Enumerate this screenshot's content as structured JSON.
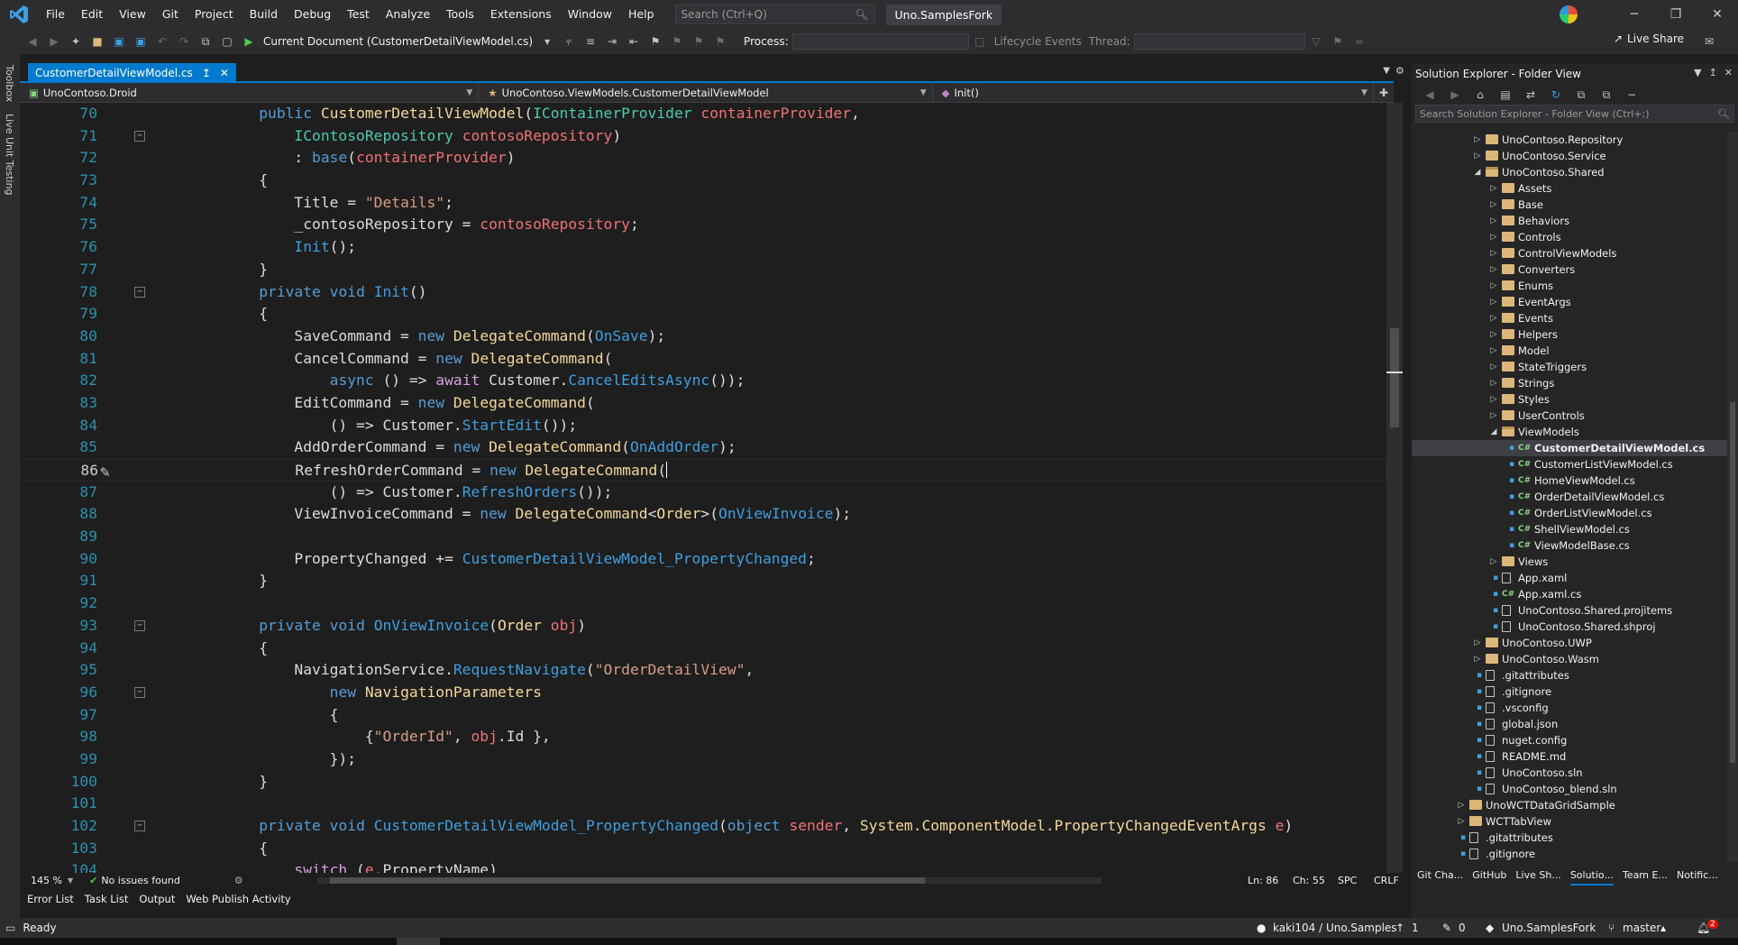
{
  "menu": {
    "items": [
      "File",
      "Edit",
      "View",
      "Git",
      "Project",
      "Build",
      "Debug",
      "Test",
      "Analyze",
      "Tools",
      "Extensions",
      "Window",
      "Help"
    ],
    "search_placeholder": "Search (Ctrl+Q)",
    "solution_name": "Uno.SamplesFork"
  },
  "toolbar": {
    "run_target": "Current Document (CustomerDetailViewModel.cs)",
    "process_label": "Process:",
    "lifecycle_label": "Lifecycle Events",
    "thread_label": "Thread:",
    "live_share": "Live Share"
  },
  "left_strip": {
    "toolbox": "Toolbox",
    "live_unit_testing": "Live Unit Testing"
  },
  "editor": {
    "tab_title": "CustomerDetailViewModel.cs",
    "nav_project": "UnoContoso.Droid",
    "nav_type": "UnoContoso.ViewModels.CustomerDetailViewModel",
    "nav_member": "Init()",
    "zoom": "145 %",
    "issues": "No issues found",
    "ln": "Ln: 86",
    "ch": "Ch: 55",
    "spc": "SPC",
    "crlf": "CRLF",
    "line_numbers": [
      "70",
      "71",
      "72",
      "73",
      "74",
      "75",
      "76",
      "77",
      "78",
      "79",
      "80",
      "81",
      "82",
      "83",
      "84",
      "85",
      "86",
      "87",
      "88",
      "89",
      "90",
      "91",
      "92",
      "93",
      "94",
      "95",
      "96",
      "97",
      "98",
      "99",
      "100",
      "101",
      "102",
      "103",
      "104"
    ]
  },
  "bottom_tabs": [
    "Error List",
    "Task List",
    "Output",
    "Web Publish Activity"
  ],
  "status": {
    "ready": "Ready",
    "repo": "kaki104 / Uno.Samples",
    "up_count": "1",
    "pencil_count": "0",
    "solution": "Uno.SamplesFork",
    "branch": "master",
    "notifications": "2"
  },
  "solution_explorer": {
    "title": "Solution Explorer - Folder View",
    "search_placeholder": "Search Solution Explorer - Folder View (Ctrl+;)",
    "tree": [
      {
        "label": "UnoContoso.Repository",
        "type": "folder",
        "level": 2,
        "arrow": "collapsed"
      },
      {
        "label": "UnoContoso.Service",
        "type": "folder",
        "level": 2,
        "arrow": "collapsed"
      },
      {
        "label": "UnoContoso.Shared",
        "type": "folder-open",
        "level": 2,
        "arrow": "expanded"
      },
      {
        "label": "Assets",
        "type": "folder",
        "level": 3,
        "arrow": "collapsed"
      },
      {
        "label": "Base",
        "type": "folder",
        "level": 3,
        "arrow": "collapsed"
      },
      {
        "label": "Behaviors",
        "type": "folder",
        "level": 3,
        "arrow": "collapsed"
      },
      {
        "label": "Controls",
        "type": "folder",
        "level": 3,
        "arrow": "collapsed"
      },
      {
        "label": "ControlViewModels",
        "type": "folder",
        "level": 3,
        "arrow": "collapsed"
      },
      {
        "label": "Converters",
        "type": "folder",
        "level": 3,
        "arrow": "collapsed"
      },
      {
        "label": "Enums",
        "type": "folder",
        "level": 3,
        "arrow": "collapsed"
      },
      {
        "label": "EventArgs",
        "type": "folder",
        "level": 3,
        "arrow": "collapsed"
      },
      {
        "label": "Events",
        "type": "folder",
        "level": 3,
        "arrow": "collapsed"
      },
      {
        "label": "Helpers",
        "type": "folder",
        "level": 3,
        "arrow": "collapsed"
      },
      {
        "label": "Model",
        "type": "folder",
        "level": 3,
        "arrow": "collapsed"
      },
      {
        "label": "StateTriggers",
        "type": "folder",
        "level": 3,
        "arrow": "collapsed"
      },
      {
        "label": "Strings",
        "type": "folder",
        "level": 3,
        "arrow": "collapsed"
      },
      {
        "label": "Styles",
        "type": "folder",
        "level": 3,
        "arrow": "collapsed"
      },
      {
        "label": "UserControls",
        "type": "folder",
        "level": 3,
        "arrow": "collapsed"
      },
      {
        "label": "ViewModels",
        "type": "folder-open",
        "level": 3,
        "arrow": "expanded"
      },
      {
        "label": "CustomerDetailViewModel.cs",
        "type": "cs",
        "level": 4,
        "selected": true
      },
      {
        "label": "CustomerListViewModel.cs",
        "type": "cs",
        "level": 4
      },
      {
        "label": "HomeViewModel.cs",
        "type": "cs",
        "level": 4
      },
      {
        "label": "OrderDetailViewModel.cs",
        "type": "cs",
        "level": 4
      },
      {
        "label": "OrderListViewModel.cs",
        "type": "cs",
        "level": 4
      },
      {
        "label": "ShellViewModel.cs",
        "type": "cs",
        "level": 4
      },
      {
        "label": "ViewModelBase.cs",
        "type": "cs",
        "level": 4
      },
      {
        "label": "Views",
        "type": "folder",
        "level": 3,
        "arrow": "collapsed"
      },
      {
        "label": "App.xaml",
        "type": "file",
        "level": 3
      },
      {
        "label": "App.xaml.cs",
        "type": "cs",
        "level": 3
      },
      {
        "label": "UnoContoso.Shared.projitems",
        "type": "file",
        "level": 3
      },
      {
        "label": "UnoContoso.Shared.shproj",
        "type": "file",
        "level": 3
      },
      {
        "label": "UnoContoso.UWP",
        "type": "folder",
        "level": 2,
        "arrow": "collapsed"
      },
      {
        "label": "UnoContoso.Wasm",
        "type": "folder",
        "level": 2,
        "arrow": "collapsed"
      },
      {
        "label": ".gitattributes",
        "type": "file",
        "level": 2
      },
      {
        "label": ".gitignore",
        "type": "file",
        "level": 2
      },
      {
        "label": ".vsconfig",
        "type": "file",
        "level": 2
      },
      {
        "label": "global.json",
        "type": "file",
        "level": 2
      },
      {
        "label": "nuget.config",
        "type": "file",
        "level": 2
      },
      {
        "label": "README.md",
        "type": "file",
        "level": 2
      },
      {
        "label": "UnoContoso.sln",
        "type": "file",
        "level": 2
      },
      {
        "label": "UnoContoso_blend.sln",
        "type": "file",
        "level": 2
      },
      {
        "label": "UnoWCTDataGridSample",
        "type": "folder",
        "level": 1,
        "arrow": "collapsed"
      },
      {
        "label": "WCTTabView",
        "type": "folder",
        "level": 1,
        "arrow": "collapsed"
      },
      {
        "label": ".gitattributes",
        "type": "file",
        "level": 1
      },
      {
        "label": ".gitignore",
        "type": "file",
        "level": 1
      },
      {
        "label": ".gitattributes",
        "type": "file",
        "level": 0
      }
    ],
    "bottom_tabs": [
      "Git Cha...",
      "GitHub",
      "Live Sh...",
      "Solutio...",
      "Team E...",
      "Notific..."
    ]
  },
  "colors": {
    "accent": "#007acc",
    "keyword": "#569cd6",
    "type": "#4ec9b0",
    "string": "#d69d85",
    "parameter": "#f07178"
  }
}
